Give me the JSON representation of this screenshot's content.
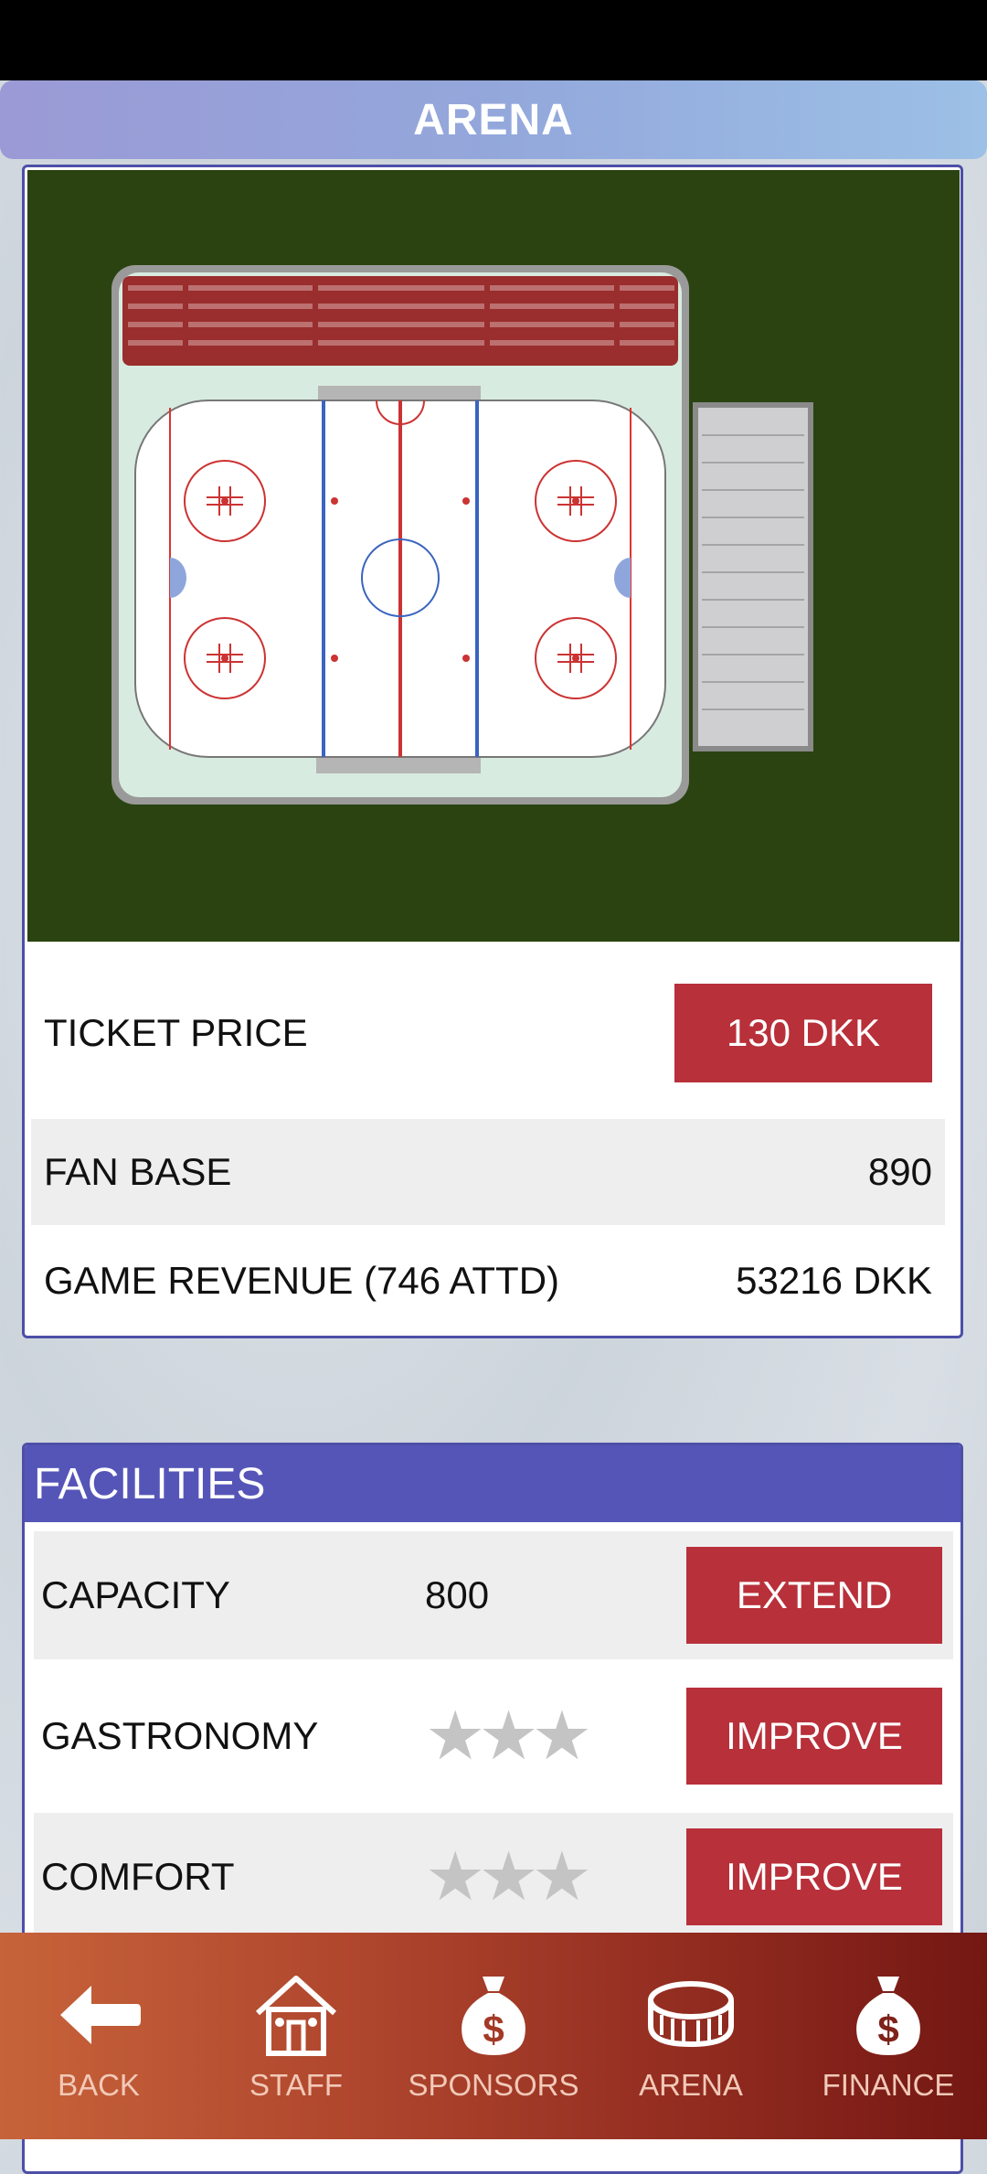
{
  "header": {
    "title": "ARENA"
  },
  "arena": {
    "ticket_price_label": "TICKET PRICE",
    "ticket_price_value": "130 DKK",
    "fan_base_label": "FAN BASE",
    "fan_base_value": "890",
    "game_revenue_label": "GAME REVENUE (746 ATTD)",
    "game_revenue_value": "53216 DKK"
  },
  "facilities": {
    "title": "FACILITIES",
    "rows": [
      {
        "label": "CAPACITY",
        "value": "800",
        "button": "EXTEND"
      },
      {
        "label": "GASTRONOMY",
        "stars": 0,
        "max_stars": 3,
        "button": "IMPROVE"
      },
      {
        "label": "COMFORT",
        "stars": 0,
        "max_stars": 3,
        "button": "IMPROVE"
      }
    ]
  },
  "nav": {
    "items": [
      {
        "label": "BACK",
        "icon": "arrow-left-icon"
      },
      {
        "label": "STAFF",
        "icon": "house-icon"
      },
      {
        "label": "SPONSORS",
        "icon": "money-bag-icon"
      },
      {
        "label": "ARENA",
        "icon": "stadium-icon"
      },
      {
        "label": "FINANCE",
        "icon": "money-bag-icon"
      }
    ]
  },
  "colors": {
    "accent_red": "#b8303a",
    "header_blue": "#5555b8",
    "field_green": "#2b4311"
  }
}
